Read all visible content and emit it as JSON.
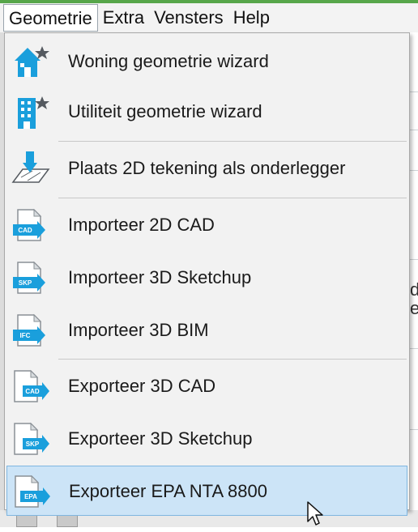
{
  "menubar": {
    "items": [
      {
        "label": "Geometrie"
      },
      {
        "label": "Extra"
      },
      {
        "label": "Vensters"
      },
      {
        "label": "Help"
      }
    ]
  },
  "background": {
    "chars": [
      "d",
      "e"
    ]
  },
  "dropdown": {
    "items": [
      {
        "label": "Woning geometrie wizard",
        "icon": "house-wizard-icon"
      },
      {
        "label": "Utiliteit geometrie wizard",
        "icon": "building-wizard-icon"
      },
      {
        "label": "Plaats 2D tekening als onderlegger",
        "icon": "place-drawing-icon"
      },
      {
        "label": "Importeer 2D CAD",
        "icon": "import-cad-icon",
        "badge": "CAD"
      },
      {
        "label": "Importeer 3D Sketchup",
        "icon": "import-skp-icon",
        "badge": "SKP"
      },
      {
        "label": "Importeer 3D BIM",
        "icon": "import-ifc-icon",
        "badge": "IFC"
      },
      {
        "label": "Exporteer 3D CAD",
        "icon": "export-cad-icon",
        "badge": "CAD"
      },
      {
        "label": "Exporteer 3D Sketchup",
        "icon": "export-skp-icon",
        "badge": "SKP"
      },
      {
        "label": "Exporteer EPA NTA 8800",
        "icon": "export-epa-icon",
        "badge": "EPA",
        "highlighted": true
      }
    ]
  },
  "colors": {
    "accent_blue": "#1a9fdc",
    "highlight_bg": "#cce4f7",
    "highlight_border": "#7fb6e0",
    "top_line_green": "#57a64a"
  }
}
